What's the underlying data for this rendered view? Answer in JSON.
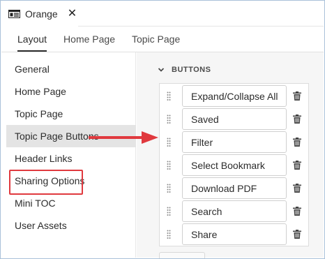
{
  "window": {
    "title": "Orange",
    "close_glyph": "✕",
    "icon": "document-icon"
  },
  "tabs": [
    {
      "label": "Layout",
      "active": true
    },
    {
      "label": "Home Page",
      "active": false
    },
    {
      "label": "Topic Page",
      "active": false
    }
  ],
  "sidebar": {
    "items": [
      {
        "label": "General",
        "selected": false
      },
      {
        "label": "Home Page",
        "selected": false
      },
      {
        "label": "Topic Page",
        "selected": false
      },
      {
        "label": "Topic Page Buttons",
        "selected": true
      },
      {
        "label": "Header Links",
        "selected": false
      },
      {
        "label": "Sharing Options",
        "selected": false,
        "highlighted": true
      },
      {
        "label": "Mini TOC",
        "selected": false
      },
      {
        "label": "User Assets",
        "selected": false
      }
    ]
  },
  "buttons_section": {
    "title": "BUTTONS",
    "expanded": true,
    "items": [
      {
        "label": "Expand/Collapse All"
      },
      {
        "label": "Saved"
      },
      {
        "label": "Filter"
      },
      {
        "label": "Select Bookmark"
      },
      {
        "label": "Download PDF"
      },
      {
        "label": "Search"
      },
      {
        "label": "Share"
      }
    ]
  },
  "colors": {
    "annotation_red": "#e0393e",
    "selected_bg": "#e4e4e4",
    "panel_bg": "#f6f6f6"
  }
}
